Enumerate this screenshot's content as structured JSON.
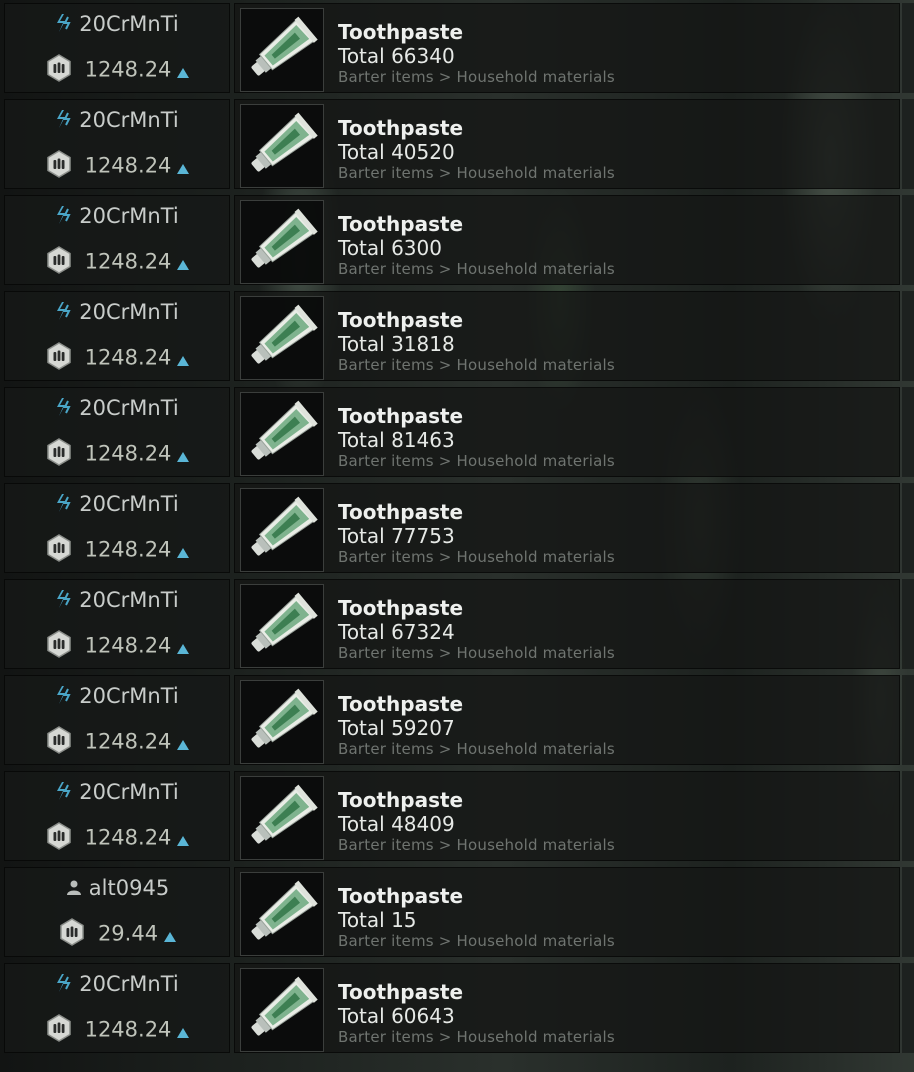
{
  "colors": {
    "accent_blue": "#4aa6c8",
    "user_icon_gray": "#b9bdbb",
    "arrow_blue": "#5ab6d6"
  },
  "icons": {
    "trader": "lightning-bolt-icon",
    "player": "user-icon",
    "currency": "currency-coin-icon",
    "trend": "arrow-up-icon",
    "item": "toothpaste-tube-icon"
  },
  "listings": [
    {
      "seller": "20CrMnTi",
      "seller_type": "trader",
      "price": "1248.24",
      "item": "Toothpaste",
      "total": "Total 66340",
      "category": "Barter items > Household materials"
    },
    {
      "seller": "20CrMnTi",
      "seller_type": "trader",
      "price": "1248.24",
      "item": "Toothpaste",
      "total": "Total 40520",
      "category": "Barter items > Household materials"
    },
    {
      "seller": "20CrMnTi",
      "seller_type": "trader",
      "price": "1248.24",
      "item": "Toothpaste",
      "total": "Total 6300",
      "category": "Barter items > Household materials"
    },
    {
      "seller": "20CrMnTi",
      "seller_type": "trader",
      "price": "1248.24",
      "item": "Toothpaste",
      "total": "Total 31818",
      "category": "Barter items > Household materials"
    },
    {
      "seller": "20CrMnTi",
      "seller_type": "trader",
      "price": "1248.24",
      "item": "Toothpaste",
      "total": "Total 81463",
      "category": "Barter items > Household materials"
    },
    {
      "seller": "20CrMnTi",
      "seller_type": "trader",
      "price": "1248.24",
      "item": "Toothpaste",
      "total": "Total 77753",
      "category": "Barter items > Household materials"
    },
    {
      "seller": "20CrMnTi",
      "seller_type": "trader",
      "price": "1248.24",
      "item": "Toothpaste",
      "total": "Total 67324",
      "category": "Barter items > Household materials"
    },
    {
      "seller": "20CrMnTi",
      "seller_type": "trader",
      "price": "1248.24",
      "item": "Toothpaste",
      "total": "Total 59207",
      "category": "Barter items > Household materials"
    },
    {
      "seller": "20CrMnTi",
      "seller_type": "trader",
      "price": "1248.24",
      "item": "Toothpaste",
      "total": "Total 48409",
      "category": "Barter items > Household materials"
    },
    {
      "seller": "alt0945",
      "seller_type": "player",
      "price": "29.44",
      "item": "Toothpaste",
      "total": "Total 15",
      "category": "Barter items > Household materials"
    },
    {
      "seller": "20CrMnTi",
      "seller_type": "trader",
      "price": "1248.24",
      "item": "Toothpaste",
      "total": "Total 60643",
      "category": "Barter items > Household materials"
    }
  ]
}
